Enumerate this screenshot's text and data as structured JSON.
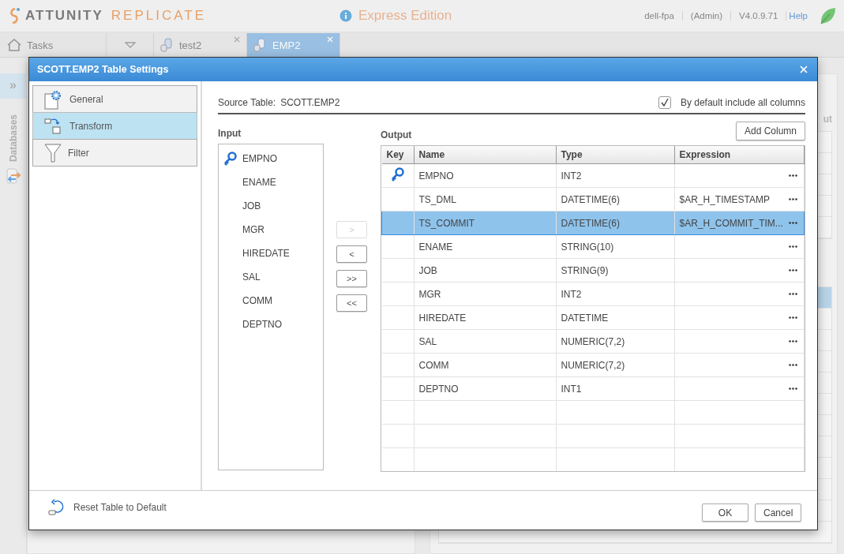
{
  "header": {
    "brand": "ATTUNITY",
    "product": "REPLICATE",
    "edition": "Express Edition",
    "user": "dell-fpa",
    "role": "(Admin)",
    "version": "V4.0.9.71",
    "help": "Help"
  },
  "tabs": [
    {
      "kind": "home",
      "label": "Tasks",
      "selected": false
    },
    {
      "kind": "dropdown",
      "selected": false
    },
    {
      "kind": "task",
      "label": "test2",
      "selected": false
    },
    {
      "kind": "task",
      "label": "EMP2",
      "selected": true
    }
  ],
  "side": {
    "expand": "»",
    "label": "Databases"
  },
  "background": {
    "fragment": "ut"
  },
  "dialog": {
    "title": "SCOTT.EMP2 Table Settings",
    "nav": [
      {
        "kind": "general",
        "label": "General",
        "selected": false
      },
      {
        "kind": "transform",
        "label": "Transform",
        "selected": true
      },
      {
        "kind": "filter",
        "label": "Filter",
        "selected": false
      }
    ],
    "source_label": "Source Table:",
    "source_value": "SCOTT.EMP2",
    "include_all": {
      "label": "By default include all columns",
      "checked": true
    },
    "input": {
      "title": "Input",
      "items": [
        {
          "name": "EMPNO",
          "key": true
        },
        {
          "name": "ENAME",
          "key": false
        },
        {
          "name": "JOB",
          "key": false
        },
        {
          "name": "MGR",
          "key": false
        },
        {
          "name": "HIREDATE",
          "key": false
        },
        {
          "name": "SAL",
          "key": false
        },
        {
          "name": "COMM",
          "key": false
        },
        {
          "name": "DEPTNO",
          "key": false
        }
      ]
    },
    "move_buttons": [
      {
        "label": ">",
        "disabled": true
      },
      {
        "label": "<",
        "disabled": false
      },
      {
        "label": ">>",
        "disabled": false
      },
      {
        "label": "<<",
        "disabled": false
      }
    ],
    "output": {
      "title": "Output",
      "add_button": "Add Column",
      "columns": [
        "Key",
        "Name",
        "Type",
        "Expression"
      ],
      "rows": [
        {
          "key": true,
          "name": "EMPNO",
          "type": "INT2",
          "expression": "",
          "selected": false
        },
        {
          "key": false,
          "name": "TS_DML",
          "type": "DATETIME(6)",
          "expression": "$AR_H_TIMESTAMP",
          "selected": false
        },
        {
          "key": false,
          "name": "TS_COMMIT",
          "type": "DATETIME(6)",
          "expression": "$AR_H_COMMIT_TIM...",
          "selected": true
        },
        {
          "key": false,
          "name": "ENAME",
          "type": "STRING(10)",
          "expression": "",
          "selected": false
        },
        {
          "key": false,
          "name": "JOB",
          "type": "STRING(9)",
          "expression": "",
          "selected": false
        },
        {
          "key": false,
          "name": "MGR",
          "type": "INT2",
          "expression": "",
          "selected": false
        },
        {
          "key": false,
          "name": "HIREDATE",
          "type": "DATETIME",
          "expression": "",
          "selected": false
        },
        {
          "key": false,
          "name": "SAL",
          "type": "NUMERIC(7,2)",
          "expression": "",
          "selected": false
        },
        {
          "key": false,
          "name": "COMM",
          "type": "NUMERIC(7,2)",
          "expression": "",
          "selected": false
        },
        {
          "key": false,
          "name": "DEPTNO",
          "type": "INT1",
          "expression": "",
          "selected": false
        }
      ]
    },
    "reset": "Reset Table to Default",
    "ok": "OK",
    "cancel": "Cancel"
  }
}
